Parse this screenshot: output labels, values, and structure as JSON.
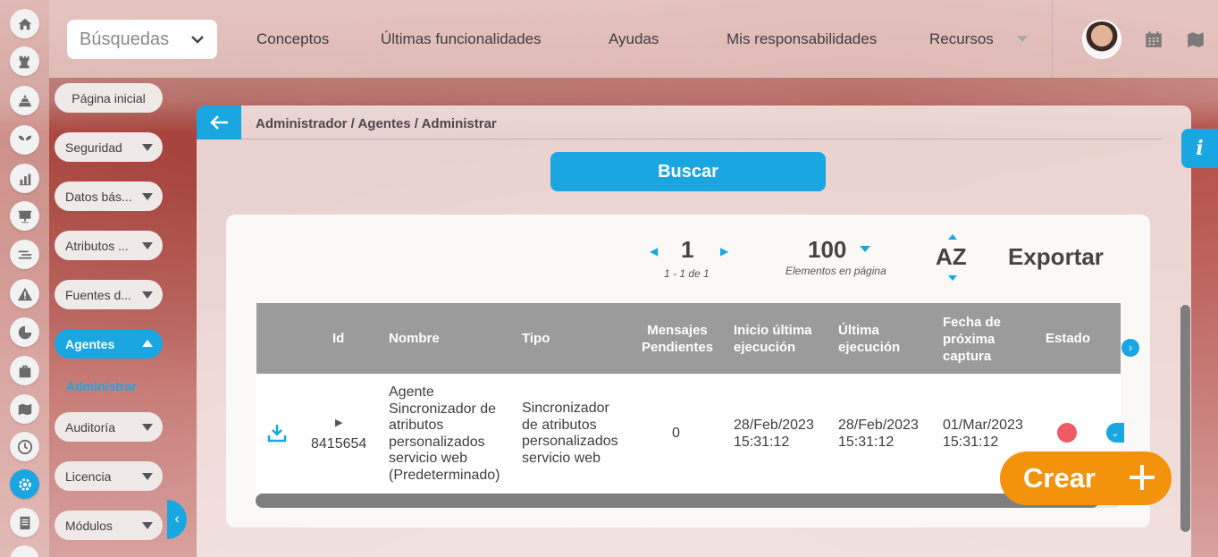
{
  "top": {
    "search_label": "Búsquedas",
    "nav": [
      "Conceptos",
      "Últimas funcionalidades",
      "Ayudas",
      "Mis responsabilidades",
      "Recursos"
    ]
  },
  "rail_icons": [
    "home-icon",
    "tower-icon",
    "pyramid-icon",
    "sprout-icon",
    "bar-chart-icon",
    "presentation-icon",
    "list-lines-icon",
    "warning-icon",
    "pie-chart-icon",
    "briefcase-icon",
    "map-icon",
    "clock-icon",
    "settings-icon",
    "document-icon"
  ],
  "menu": {
    "home": "Página inicial",
    "items": [
      "Seguridad",
      "Datos bás...",
      "Atributos ...",
      "Fuentes d...",
      "Agentes",
      "Auditoría",
      "Licencia",
      "Módulos"
    ],
    "active_item": "Agentes",
    "sub_active": "Administrar"
  },
  "breadcrumb": "Administrador / Agentes / Administrar",
  "buscar_label": "Buscar",
  "pager": {
    "page": "1",
    "range": "1 - 1 de 1",
    "per_page": "100",
    "per_page_label": "Elementos en página",
    "sort_label": "AZ",
    "export_label": "Exportar"
  },
  "table": {
    "headers": {
      "id": "Id",
      "nombre": "Nombre",
      "tipo": "Tipo",
      "mensajes": "Mensajes Pendientes",
      "inicio": "Inicio última ejecución",
      "ultima": "Última ejecución",
      "fecha": "Fecha de próxima captura",
      "estado": "Estado"
    },
    "rows": [
      {
        "id": "8415654",
        "nombre": "Agente Sincronizador de atributos personalizados servicio web (Predeterminado)",
        "tipo": "Sincronizador de atributos personalizados servicio web",
        "mensajes": "0",
        "inicio": "28/Feb/2023 15:31:12",
        "ultima": "28/Feb/2023 15:31:12",
        "fecha": "01/Mar/2023 15:31:12",
        "estado_color": "#ef5b62"
      }
    ]
  },
  "crear_label": "Crear",
  "colors": {
    "accent": "#1aa6e0",
    "create": "#f3920b",
    "status_red": "#ef5b62"
  }
}
